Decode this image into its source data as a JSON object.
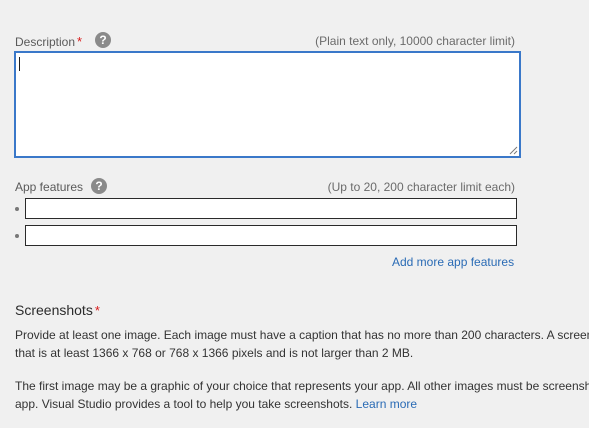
{
  "description": {
    "label": "Description",
    "required_mark": "*",
    "help_icon": "?",
    "hint": "(Plain text only, 10000 character limit)",
    "value": ""
  },
  "app_features": {
    "label": "App features",
    "help_icon": "?",
    "hint": "(Up to 20, 200 character limit each)",
    "items": [
      "",
      ""
    ],
    "add_more_link": "Add more app features"
  },
  "screenshots": {
    "title": "Screenshots",
    "required_mark": "*",
    "para1_line1": "Provide at least one image. Each image must have a caption that has no more than 200 characters. A screens",
    "para1_line2": "that is at least 1366 x 768 or 768 x 1366 pixels and is not larger than 2 MB.",
    "para2_line1": "The first image may be a graphic of your choice that represents your app. All other images must be screensho",
    "para2_line2_text": "app. Visual Studio provides a tool to help you take screenshots.",
    "learn_more_link": "Learn more"
  },
  "colors": {
    "accent": "#3a78c9",
    "link": "#2a6bb5",
    "required": "#d81b1b"
  }
}
